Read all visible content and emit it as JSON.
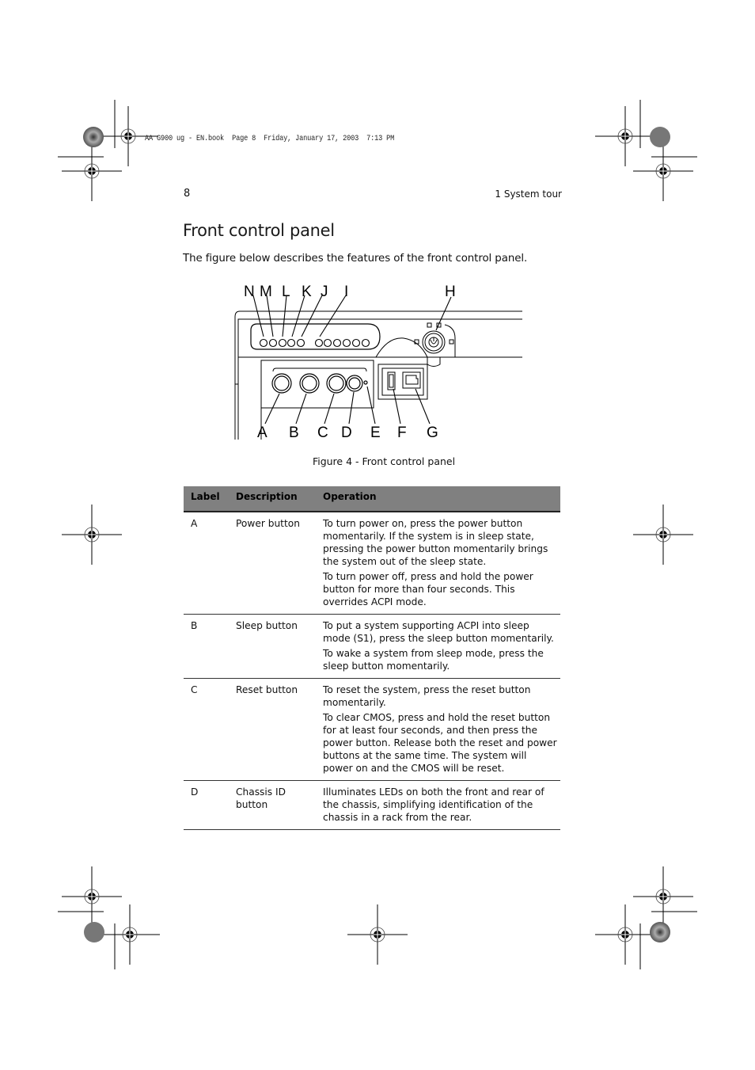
{
  "slug_line": "AA G900 ug - EN.book  Page 8  Friday, January 17, 2003  7:13 PM",
  "header": {
    "page_number": "8",
    "running_head": "1 System tour"
  },
  "section": {
    "title": "Front control panel",
    "intro": "The figure below describes the features of the front control panel."
  },
  "figure": {
    "top_callouts": [
      "N",
      "M",
      "L",
      "K",
      "J",
      "I",
      "H"
    ],
    "bottom_callouts": [
      "A",
      "B",
      "C",
      "D",
      "E",
      "F",
      "G"
    ],
    "caption": "Figure 4 - Front control panel"
  },
  "table": {
    "headers": [
      "Label",
      "Description",
      "Operation"
    ],
    "rows": [
      {
        "label": "A",
        "description": "Power button",
        "operation": [
          "To turn power on, press the power button momentarily.  If the system is in sleep state, pressing the power button momentarily brings the system out of the sleep state.",
          "To turn power off, press and hold the power button for more than four seconds.  This overrides ACPI mode."
        ]
      },
      {
        "label": "B",
        "description": "Sleep button",
        "operation": [
          "To put a system supporting ACPI into sleep mode (S1), press the sleep button momentarily.",
          "To wake a system from sleep mode, press the sleep button momentarily."
        ]
      },
      {
        "label": "C",
        "description": "Reset button",
        "operation": [
          "To reset the system, press the reset button momentarily.",
          "To clear CMOS, press and hold the reset button for at least four seconds, and then press the power button.  Release both the reset and power buttons at the same time.  The system will power on and the CMOS will be reset."
        ]
      },
      {
        "label": "D",
        "description": "Chassis ID button",
        "operation": [
          "Illuminates LEDs on both the front and rear of the chassis, simplifying identification of the chassis in a rack from the rear."
        ]
      }
    ]
  }
}
